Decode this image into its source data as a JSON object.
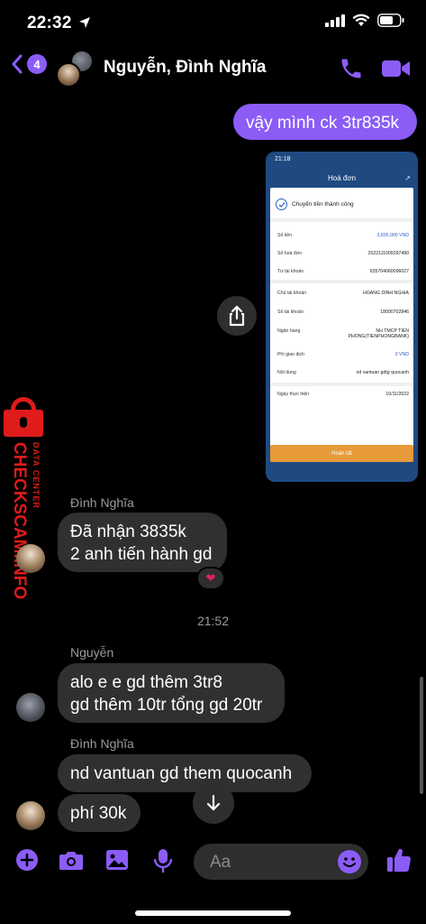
{
  "status": {
    "time": "22:32"
  },
  "header": {
    "back_count": "4",
    "title": "Nguyễn, Đình Nghĩa"
  },
  "colors": {
    "accent": "#8b5cf6",
    "incoming_bubble": "#303030",
    "background": "#000000",
    "watermark": "#e01b1b"
  },
  "watermark": {
    "brand": "CHECKSCAM.INFO",
    "sub": "DATA CENTER"
  },
  "messages": {
    "outgoing_1": "vậy mình ck 3tr835k",
    "sender_nghia": "Đình Nghĩa",
    "nghia_line1": "Đã nhận 3835k",
    "nghia_line2": "2 anh tiến hành gd",
    "reaction": "❤",
    "time_separator": "21:52",
    "sender_nguyen": "Nguyễn",
    "nguyen_line1": "alo e e gd thêm 3tr8",
    "nguyen_line2": "gd thêm 10tr tổng gd 20tr",
    "sender_nghia_2": "Đình Nghĩa",
    "nghia_msg2": "nd vantuan gd them quocanh",
    "nghia_msg3": "phí 30k"
  },
  "receipt": {
    "status_time": "21:18",
    "title": "Hoá đơn",
    "success_text": "Chuyển tiền thành công",
    "rows_group1": [
      {
        "label": "Số tiền",
        "value": "3,835,000 VND"
      },
      {
        "label": "Số hoá đơn",
        "value": "2022111009297480"
      },
      {
        "label": "Từ tài khoản",
        "value": "635704060096027"
      }
    ],
    "rows_group2": [
      {
        "label": "Chủ tài khoản",
        "value": "HOANG DINH NGHIA"
      },
      {
        "label": "Số tài khoản",
        "value": "18090702846"
      },
      {
        "label": "Ngân hàng",
        "value": "NH TMCP TIEN PHONG(TIENPHONGBANK)"
      },
      {
        "label": "Phí giao dịch",
        "value": "0 VND"
      },
      {
        "label": "Nội dung",
        "value": "nd vantuan gdtg quocanh"
      }
    ],
    "rows_group3": [
      {
        "label": "Ngày thực hiện",
        "value": "10/11/2022"
      }
    ],
    "done_button": "Hoàn tất"
  },
  "composer": {
    "placeholder": "Aa"
  }
}
